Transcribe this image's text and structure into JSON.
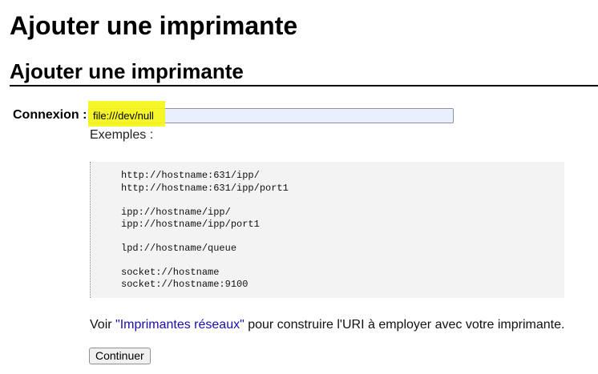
{
  "page": {
    "title": "Ajouter une imprimante",
    "section_title": "Ajouter une imprimante"
  },
  "connection": {
    "label": "Connexion :",
    "value": "file:///dev/null",
    "highlight_color": "#f5f516"
  },
  "examples": {
    "label": "Exemples :",
    "lines": [
      "http://hostname:631/ipp/",
      "http://hostname:631/ipp/port1",
      "ipp://hostname/ipp/",
      "ipp://hostname/ipp/port1",
      "lpd://hostname/queue",
      "socket://hostname",
      "socket://hostname:9100"
    ]
  },
  "note": {
    "prefix": "Voir ",
    "link_text": "\"Imprimantes réseaux\"",
    "suffix": " pour construire l'URI à employer avec votre imprimante."
  },
  "buttons": {
    "continue_label": "Continuer"
  },
  "colors": {
    "link": "#1a0dab",
    "input_background": "#e8f0fe",
    "code_background": "#f3f3f3"
  }
}
